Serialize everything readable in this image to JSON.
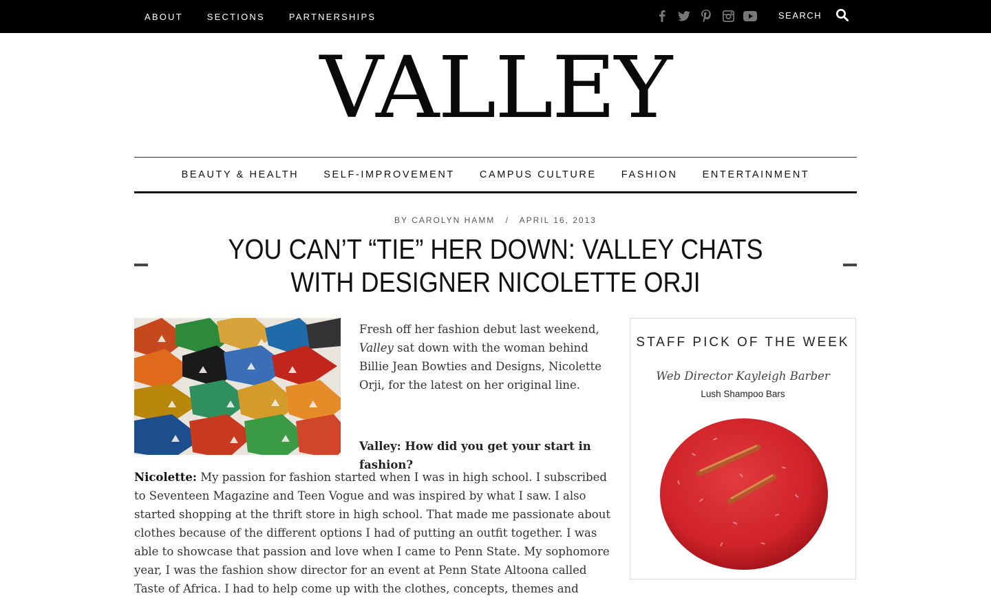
{
  "topnav": {
    "items": [
      "ABOUT",
      "SECTIONS",
      "PARTNERSHIPS"
    ]
  },
  "social": {
    "icons": [
      "facebook-icon",
      "twitter-icon",
      "pinterest-icon",
      "instagram-icon",
      "youtube-icon"
    ]
  },
  "search": {
    "label": "SEARCH"
  },
  "logo": {
    "text": "VALLEY"
  },
  "categories": [
    "BEAUTY & HEALTH",
    "SELF-IMPROVEMENT",
    "CAMPUS CULTURE",
    "FASHION",
    "ENTERTAINMENT"
  ],
  "article": {
    "by": "BY",
    "author": "CAROLYN HAMM",
    "sep": "/",
    "date": "APRIL 16, 2013",
    "title": "YOU CAN’T “TIE” HER DOWN: VALLEY CHATS WITH DESIGNER NICOLETTE ORJI",
    "intro_before": "Fresh off her fashion debut last weekend, ",
    "intro_em": "Valley",
    "intro_after": " sat down with the woman behind Billie Jean Bowties and Designs, Nicolette Orji, for the latest on her original line.",
    "question": "Valley: How did you get your start in fashion?",
    "answer_speaker": "Nicolette:",
    "answer_text": " My passion for fashion started when I was in high school. I subscribed to Seventeen Magazine and Teen Vogue and was inspired by what I saw. I also started shopping at the thrift store in high school. That made me passionate about clothes because of the different options I had of putting an outfit together. I was able to showcase that passion and love when I came to Penn State. My sophomore year, I was the fashion show director for an event at Penn State Altoona called Taste of Africa. I had to help come up with the clothes, concepts, themes and"
  },
  "sidebar": {
    "heading": "STAFF PICK OF THE WEEK",
    "staffer": "Web Director Kayleigh Barber",
    "product": "Lush Shampoo Bars"
  },
  "colors": {
    "topbar": "#000000",
    "text": "#111111",
    "product_red": "#d42a2f"
  }
}
